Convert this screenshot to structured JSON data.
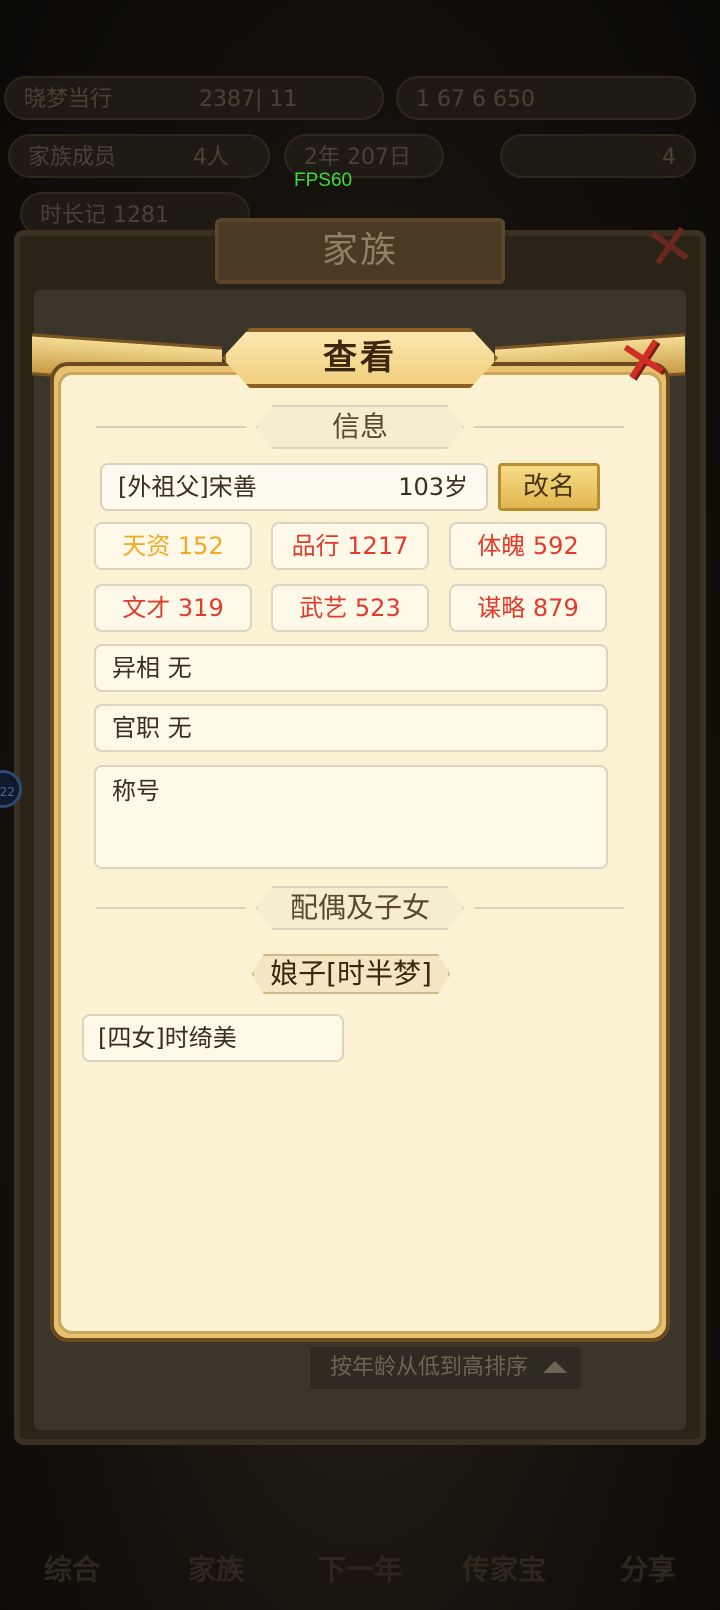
{
  "fps": "FPS60",
  "background": {
    "top_bar": {
      "left_text": "晓梦当行",
      "mid_text": "2387| 11",
      "right_text": "1 67 6 650"
    },
    "second_bar": {
      "left_text": "家族成员",
      "left_count": "4人",
      "mid_text": "2年 207日",
      "right_text": "4"
    },
    "third_bar": {
      "text": "时长记 1281"
    },
    "family_title": "家族",
    "sort_label": "按年龄从低到高排序",
    "side_badge": "22",
    "bottom_nav": [
      "综合",
      "家族",
      "下一年",
      "传家宝",
      "分享"
    ]
  },
  "modal": {
    "title": "查看",
    "info_section_title": "信息",
    "person": {
      "name": "[外祖父]宋善",
      "age": "103岁"
    },
    "rename_label": "改名",
    "stats": [
      {
        "label": "天资",
        "value": "152",
        "color": "#f2a921"
      },
      {
        "label": "品行",
        "value": "1217",
        "color": "#e33a2a"
      },
      {
        "label": "体魄",
        "value": "592",
        "color": "#e33a2a"
      },
      {
        "label": "文才",
        "value": "319",
        "color": "#e33a2a"
      },
      {
        "label": "武艺",
        "value": "523",
        "color": "#e33a2a"
      },
      {
        "label": "谋略",
        "value": "879",
        "color": "#e33a2a"
      }
    ],
    "yixiang": "异相 无",
    "guanzhi": "官职 无",
    "chenghao_label": "称号",
    "family_section_title": "配偶及子女",
    "spouse": "娘子[时半梦]",
    "children": [
      "[四女]时绮美"
    ]
  }
}
